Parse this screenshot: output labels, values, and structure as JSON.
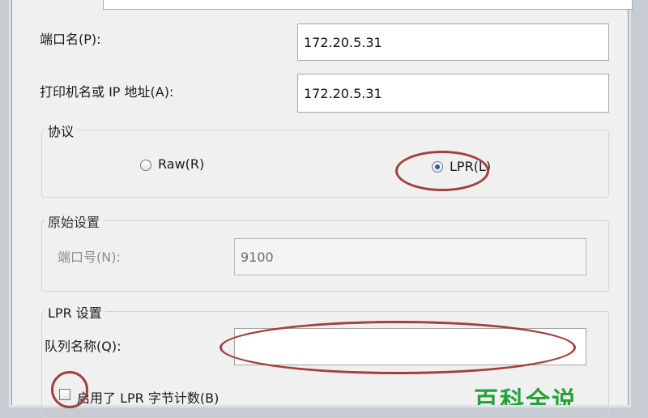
{
  "port_name": {
    "label": "端口名(P):",
    "value": "172.20.5.31"
  },
  "printer_address": {
    "label": "打印机名或 IP 地址(A):",
    "value": "172.20.5.31"
  },
  "protocol": {
    "title": "协议",
    "raw_label": "Raw(R)",
    "lpr_label": "LPR(L)",
    "selected": "LPR"
  },
  "raw_settings": {
    "title": "原始设置",
    "port_number_label": "端口号(N):",
    "port_number_value": "9100"
  },
  "lpr_settings": {
    "title": "LPR 设置",
    "queue_name_label": "队列名称(Q):",
    "queue_name_value": "",
    "byte_count_label": "启用了 LPR 字节计数(B)",
    "byte_count_checked": false
  },
  "watermark": "百科全说",
  "annotation_color": "#a1403f"
}
